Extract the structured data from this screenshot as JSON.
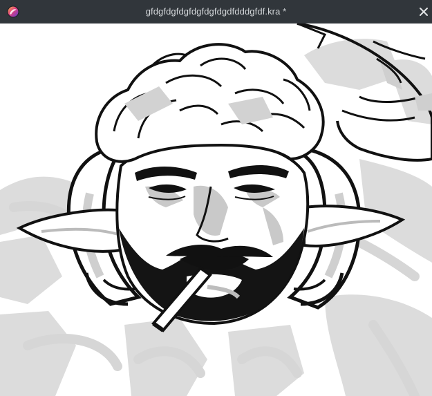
{
  "window": {
    "title": "gfdgfdgfdgfdgfdgfdgdfdddgfdf.kra *",
    "app_icon": "krita-icon",
    "close_icon": "close-icon"
  },
  "canvas": {
    "content": "drawing"
  },
  "colors": {
    "titlebar_bg": "#31363b",
    "titlebar_text": "#d3d6d9",
    "canvas_bg": "#ffffff",
    "ink": "#111111",
    "shade": "#c8c8c8",
    "sketch_gray": "#dadada"
  }
}
